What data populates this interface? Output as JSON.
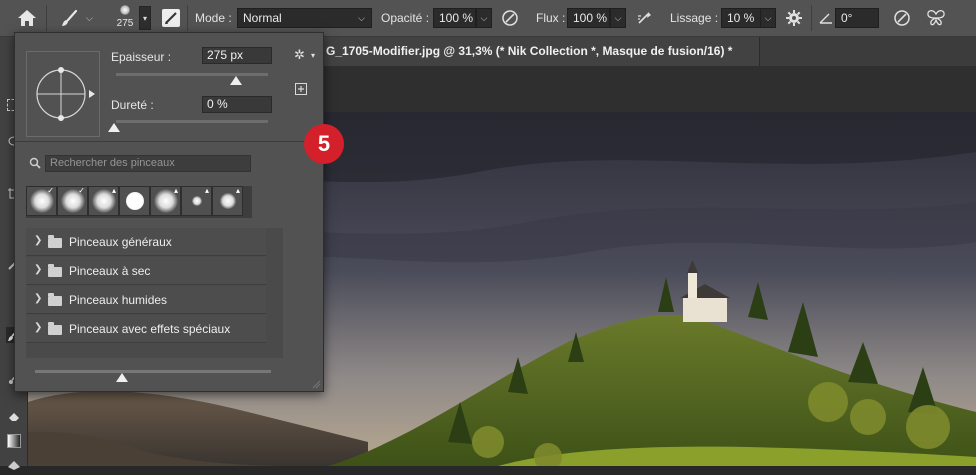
{
  "options_bar": {
    "brush_size": "275",
    "mode_label": "Mode :",
    "mode_value": "Normal",
    "opacity_label": "Opacité :",
    "opacity_value": "100 %",
    "flow_label": "Flux :",
    "flow_value": "100 %",
    "smoothing_label": "Lissage :",
    "smoothing_value": "10 %",
    "angle_value": "0°"
  },
  "document_tab": {
    "title": "G_1705-Modifier.jpg @ 31,3% (* Nik Collection *, Masque de fusion/16) *"
  },
  "brush_panel": {
    "size_label": "Epaisseur :",
    "size_value": "275 px",
    "size_fraction": 0.79,
    "hardness_label": "Dureté :",
    "hardness_value": "0 %",
    "search_placeholder": "Rechercher des pinceaux",
    "presets": [
      {
        "icon": "soft-round-brush-icon",
        "marker": "✓"
      },
      {
        "icon": "soft-round-brush-icon",
        "marker": "✓"
      },
      {
        "icon": "soft-round-brush-icon",
        "marker": "▴"
      },
      {
        "icon": "hard-round-brush-icon",
        "marker": ""
      },
      {
        "icon": "soft-round-brush-icon",
        "marker": "▴"
      },
      {
        "icon": "small-round-brush-icon",
        "marker": "▴"
      },
      {
        "icon": "small-round-brush-icon",
        "marker": "▴"
      }
    ],
    "groups": [
      "Pinceaux généraux",
      "Pinceaux à sec",
      "Pinceaux humides",
      "Pinceaux avec effets spéciaux"
    ],
    "preview_size_fraction": 0.37
  },
  "callout_badge": "5",
  "colors": {
    "badge": "#d4202a",
    "panel_bg": "#525252",
    "optbar_bg": "#535353"
  }
}
